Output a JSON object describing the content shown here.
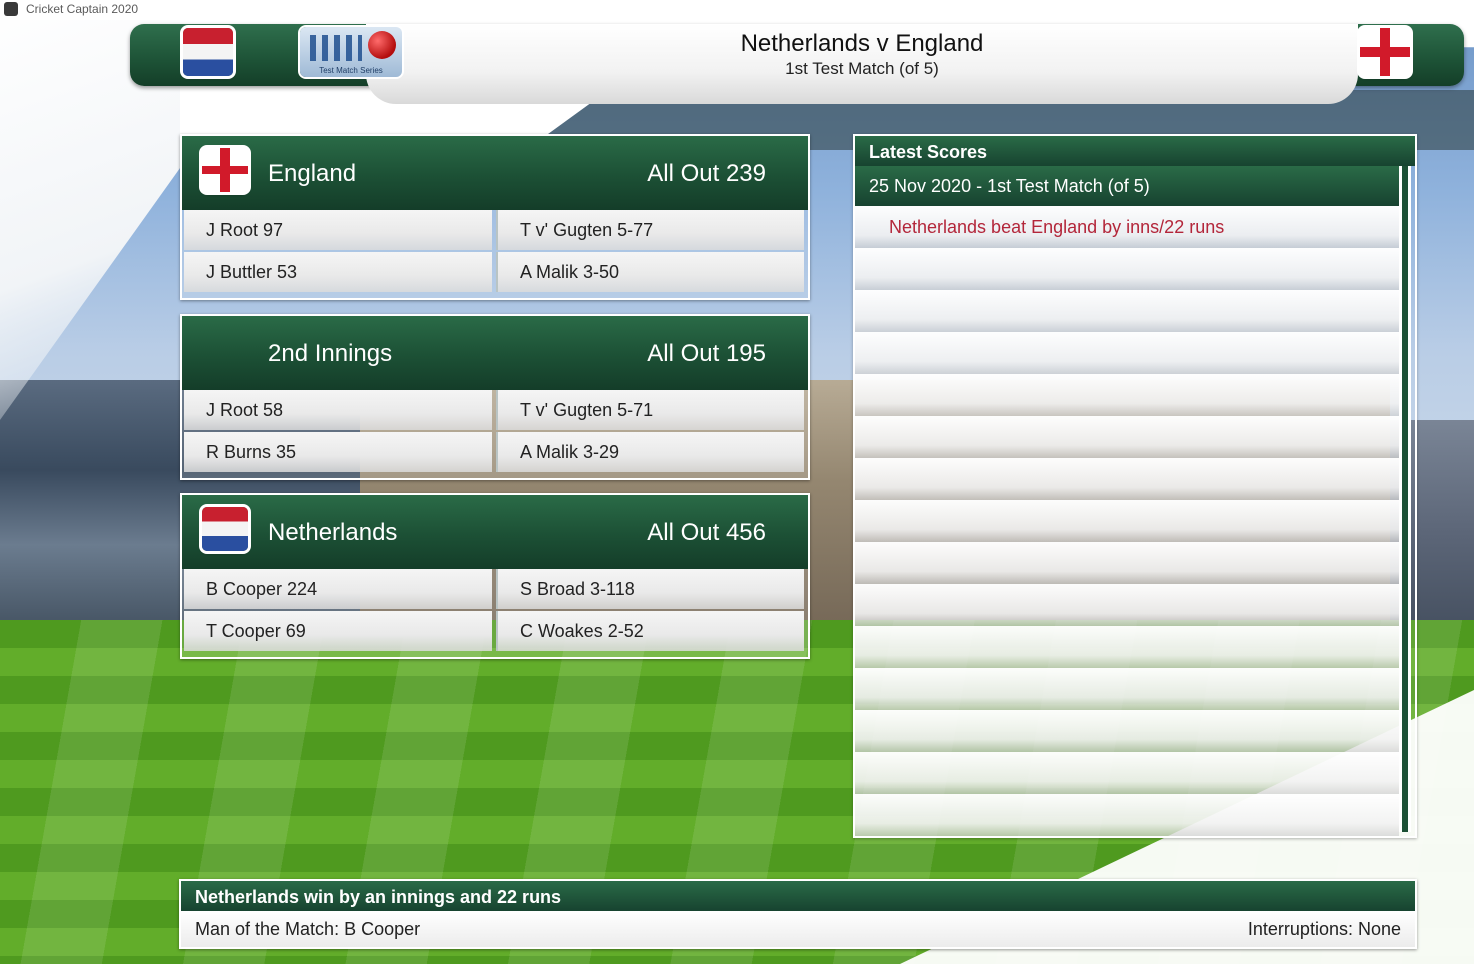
{
  "window": {
    "title": "Cricket Captain 2020"
  },
  "header": {
    "title": "Netherlands v England",
    "subtitle": "1st Test Match (of 5)",
    "logo_text": "Test Match Series"
  },
  "innings": [
    {
      "team": "England",
      "score": "All Out 239",
      "flag": "england-flag",
      "batting": [
        "J Root 97",
        "J Buttler 53"
      ],
      "bowling": [
        "T v' Gugten 5-77",
        "A Malik 3-50"
      ]
    },
    {
      "team": "2nd Innings",
      "score": "All Out 195",
      "flag": "",
      "batting": [
        "J Root 58",
        "R Burns 35"
      ],
      "bowling": [
        "T v' Gugten 5-71",
        "A Malik 3-29"
      ]
    },
    {
      "team": "Netherlands",
      "score": "All Out 456",
      "flag": "netherlands-flag",
      "batting": [
        "B Cooper 224",
        "T Cooper 69"
      ],
      "bowling": [
        "S Broad 3-118",
        "C Woakes 2-52"
      ]
    }
  ],
  "latest_scores": {
    "title": "Latest Scores",
    "date_match": "25 Nov 2020 - 1st Test Match (of 5)",
    "results": [
      "Netherlands beat England by inns/22 runs"
    ]
  },
  "result": {
    "title": "Netherlands win by an innings and 22 runs",
    "man_of_match": "Man of the Match: B Cooper",
    "interruptions": "Interruptions: None"
  },
  "colors": {
    "panel_green": "#1c5035",
    "result_red": "#b3263a"
  }
}
